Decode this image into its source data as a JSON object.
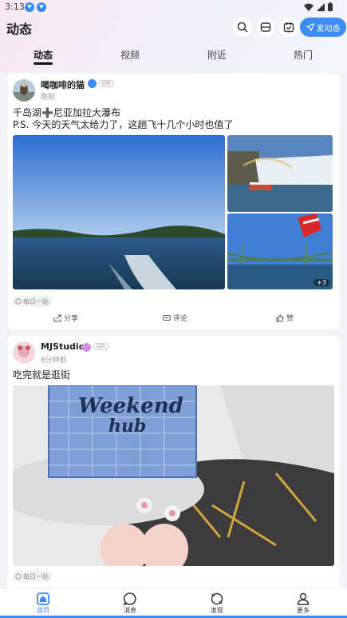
{
  "status_bar": {
    "time": "3:13"
  },
  "header": {
    "title": "动态",
    "post_button": "发动态"
  },
  "tabs": [
    {
      "label": "动态",
      "active": true
    },
    {
      "label": "视频",
      "active": false
    },
    {
      "label": "附近",
      "active": false
    },
    {
      "label": "热门",
      "active": false
    }
  ],
  "posts": [
    {
      "username": "喝咖啡的猫",
      "level": "LV6",
      "time": "刚刚",
      "text_line1": "千岛湖➕尼亚加拉大瀑布",
      "text_line2": "P.S. 今天的天气太给力了，这趟飞十几个小时也值了",
      "more_images": "+3",
      "tag": "每日一贴",
      "actions": {
        "share": "分享",
        "comment": "评论",
        "like": "赞"
      }
    },
    {
      "username": "MJStudio",
      "level": "LV0",
      "time": "8分钟前",
      "text": "吃完就是逛街",
      "bag_text_line1": "Weekend",
      "bag_text_line2": "hub",
      "tag": "每日一贴"
    }
  ],
  "bottom_nav": [
    {
      "label": "首页",
      "icon": "home-icon",
      "active": true
    },
    {
      "label": "消息",
      "icon": "message-icon",
      "active": false
    },
    {
      "label": "发现",
      "icon": "discover-icon",
      "active": false
    },
    {
      "label": "更多",
      "icon": "user-icon",
      "active": false
    }
  ],
  "colors": {
    "accent": "#3d8cf6",
    "background": "#f2f3f7"
  }
}
